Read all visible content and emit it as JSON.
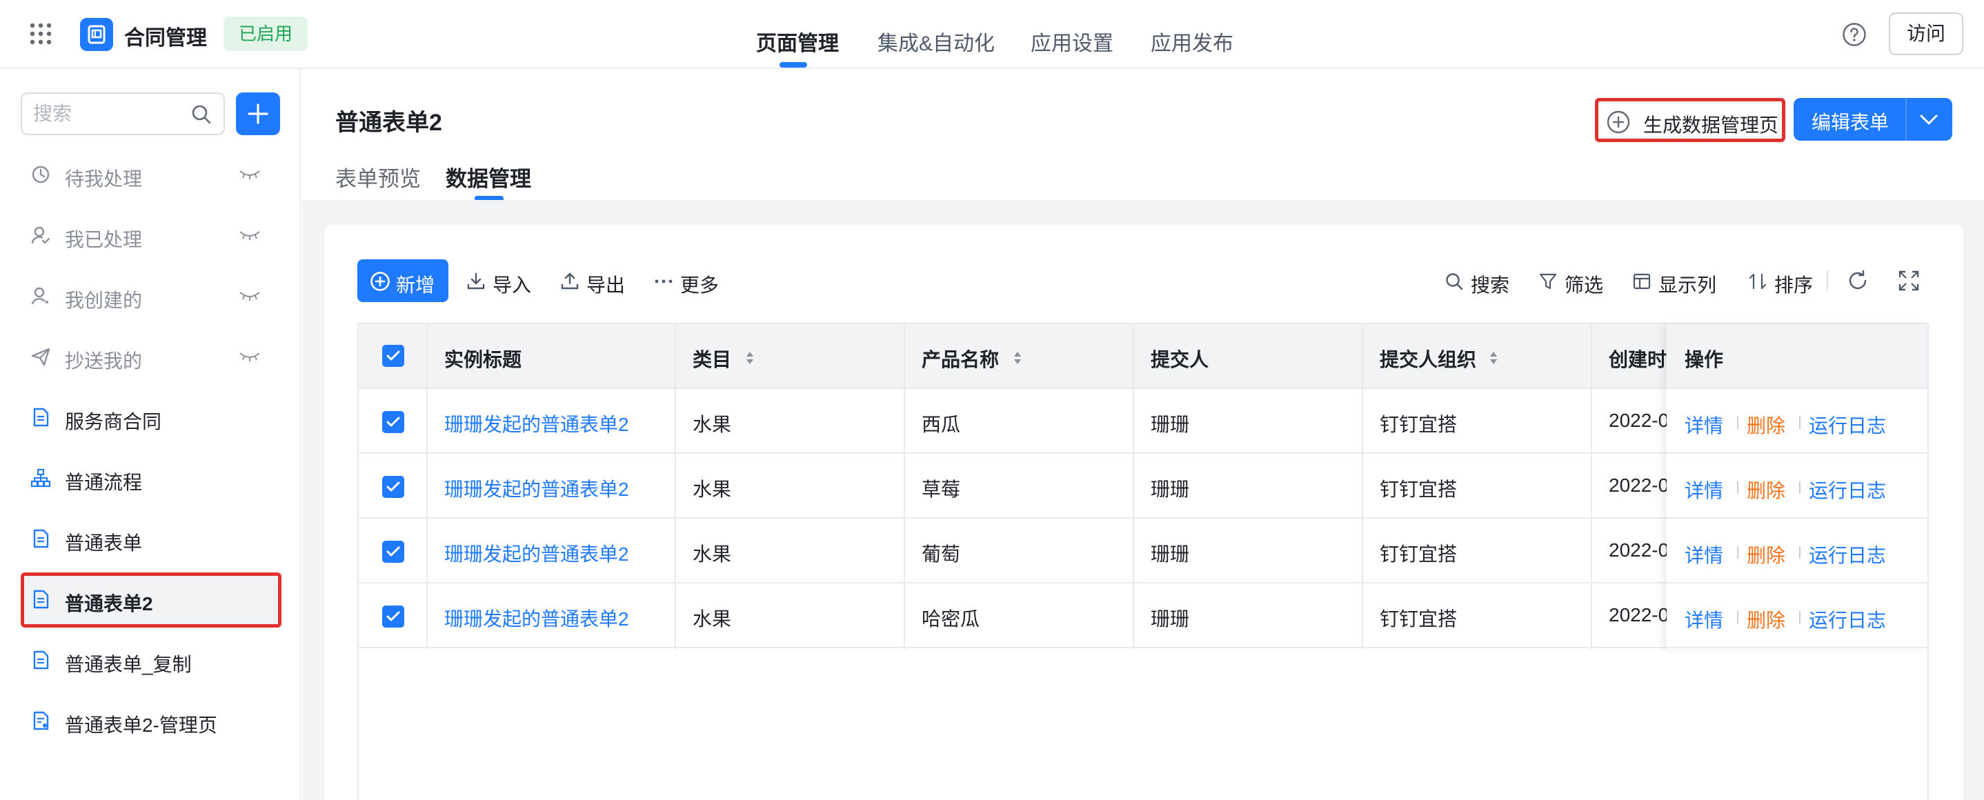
{
  "app": {
    "name": "合同管理",
    "status": "已启用"
  },
  "topnav": {
    "items": [
      "页面管理",
      "集成&自动化",
      "应用设置",
      "应用发布"
    ],
    "active": "页面管理"
  },
  "header_actions": {
    "visit_label": "访问"
  },
  "sidebar": {
    "search_placeholder": "搜索",
    "items": [
      {
        "label": "待我处理",
        "icon": "clock-icon",
        "hidden": true
      },
      {
        "label": "我已处理",
        "icon": "user-check-icon",
        "hidden": true
      },
      {
        "label": "我创建的",
        "icon": "user-icon",
        "hidden": true
      },
      {
        "label": "抄送我的",
        "icon": "send-icon",
        "hidden": true
      },
      {
        "label": "服务商合同",
        "icon": "form-icon",
        "hidden": false
      },
      {
        "label": "普通流程",
        "icon": "flow-icon",
        "hidden": false
      },
      {
        "label": "普通表单",
        "icon": "form-icon",
        "hidden": false
      },
      {
        "label": "普通表单2",
        "icon": "form-icon",
        "hidden": false,
        "active": true
      },
      {
        "label": "普通表单_复制",
        "icon": "form-icon",
        "hidden": false
      },
      {
        "label": "普通表单2-管理页",
        "icon": "manage-page-icon",
        "hidden": false
      }
    ]
  },
  "page": {
    "title": "普通表单2",
    "tabs": [
      "表单预览",
      "数据管理"
    ],
    "active_tab": "数据管理",
    "generate_label": "生成数据管理页",
    "edit_label": "编辑表单"
  },
  "toolbar": {
    "new_label": "新增",
    "import_label": "导入",
    "export_label": "导出",
    "more_label": "更多",
    "search_label": "搜索",
    "filter_label": "筛选",
    "columns_label": "显示列",
    "sort_label": "排序"
  },
  "table": {
    "columns": [
      "实例标题",
      "类目",
      "产品名称",
      "提交人",
      "提交人组织",
      "创建时间",
      "操作"
    ],
    "created_col_visible": "创建时",
    "rows": [
      {
        "title": "珊珊发起的普通表单2",
        "category": "水果",
        "product": "西瓜",
        "submitter": "珊珊",
        "org": "钉钉宜搭",
        "created": "2022-0"
      },
      {
        "title": "珊珊发起的普通表单2",
        "category": "水果",
        "product": "草莓",
        "submitter": "珊珊",
        "org": "钉钉宜搭",
        "created": "2022-0"
      },
      {
        "title": "珊珊发起的普通表单2",
        "category": "水果",
        "product": "葡萄",
        "submitter": "珊珊",
        "org": "钉钉宜搭",
        "created": "2022-0"
      },
      {
        "title": "珊珊发起的普通表单2",
        "category": "水果",
        "product": "哈密瓜",
        "submitter": "珊珊",
        "org": "钉钉宜搭",
        "created": "2022-0"
      }
    ],
    "ops": {
      "detail": "详情",
      "delete": "删除",
      "log": "运行日志"
    }
  },
  "colors": {
    "primary": "#1f7aff",
    "danger_link": "#f5731b",
    "enabled_bg": "#e3f5e8",
    "enabled_text": "#21a557",
    "highlight": "#e03131"
  }
}
